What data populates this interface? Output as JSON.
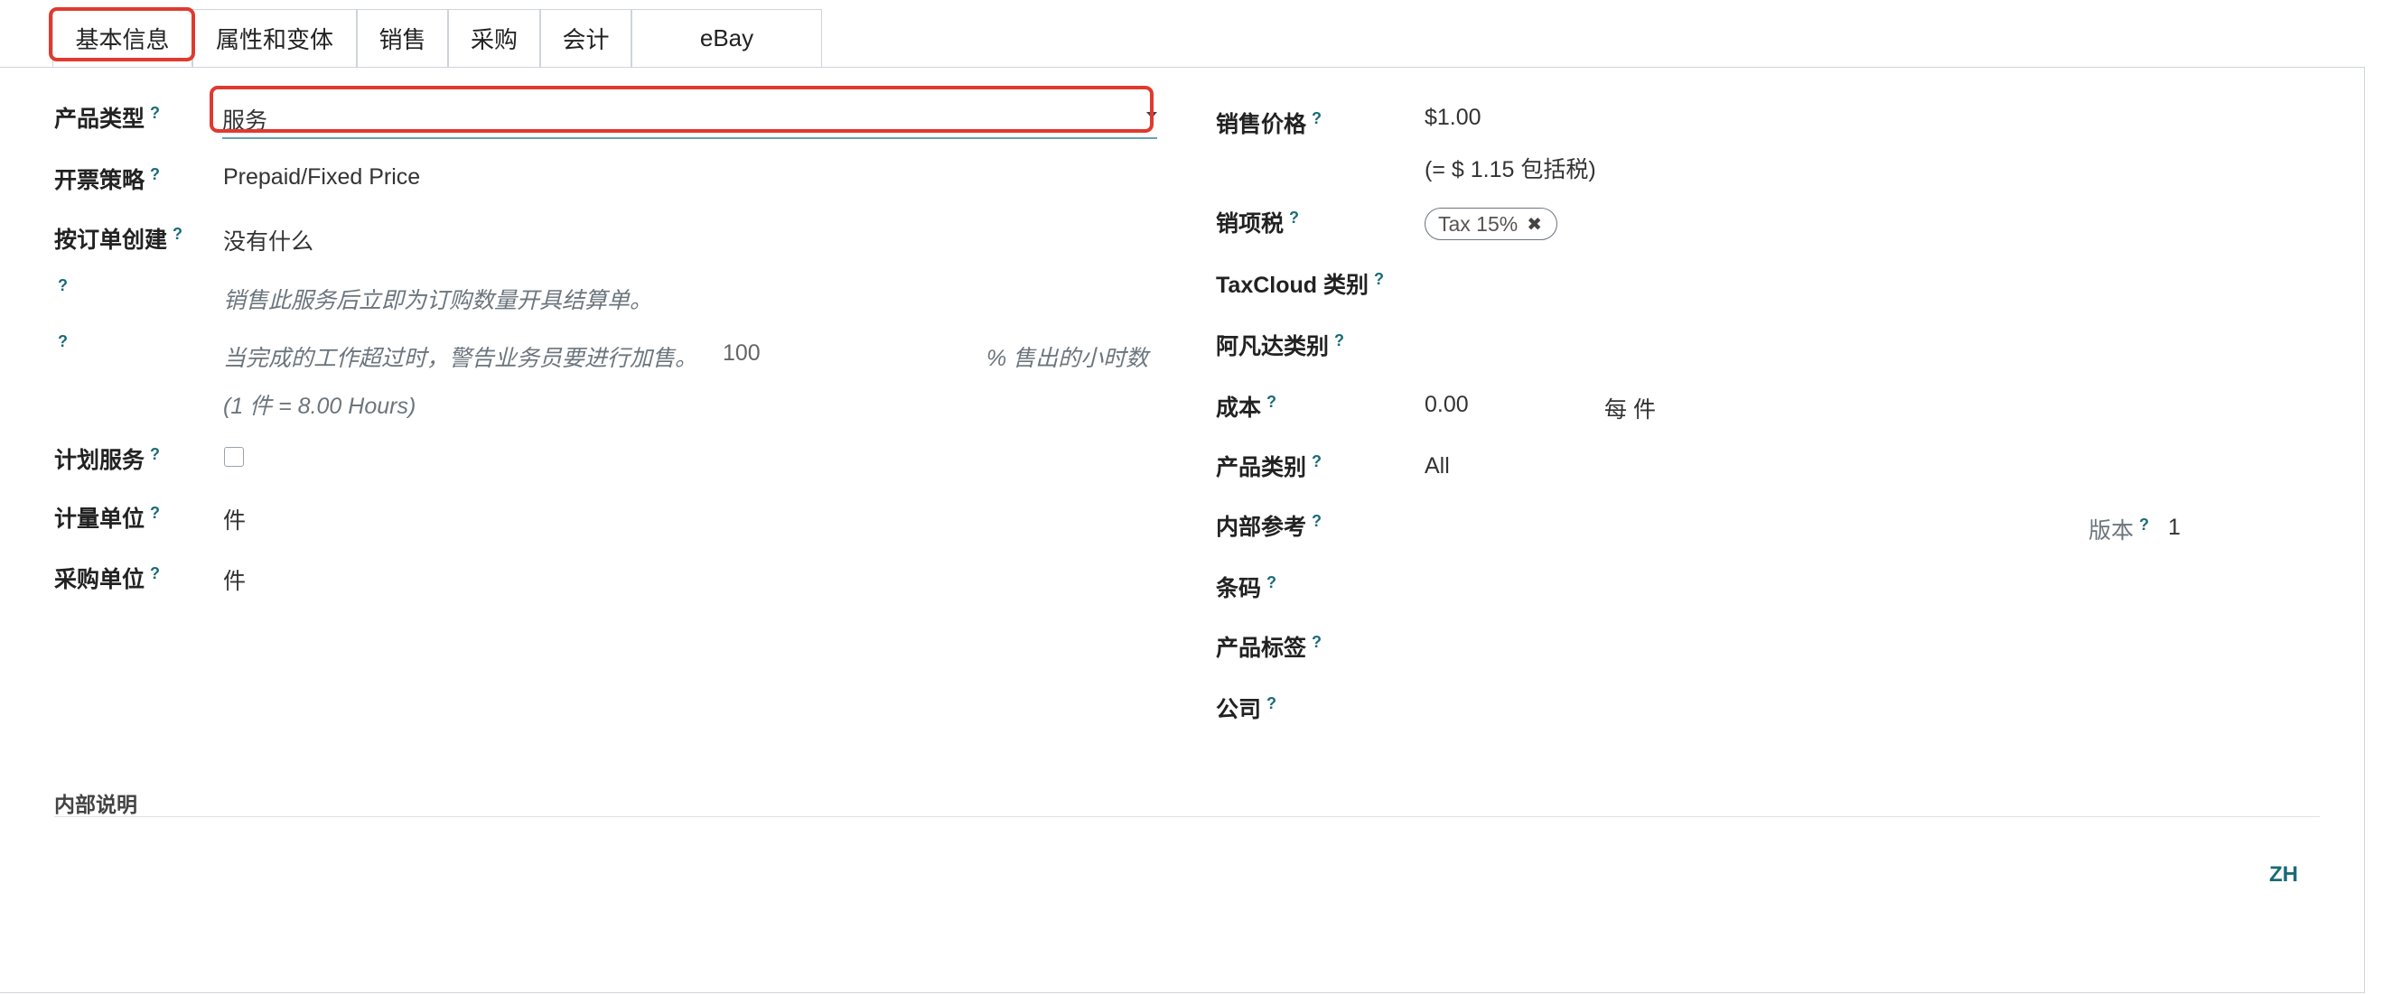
{
  "tabs": [
    {
      "label": "基本信息",
      "active": true
    },
    {
      "label": "属性和变体",
      "active": false
    },
    {
      "label": "销售",
      "active": false
    },
    {
      "label": "采购",
      "active": false
    },
    {
      "label": "会计",
      "active": false
    },
    {
      "label": "eBay",
      "active": false
    }
  ],
  "help_mark": "?",
  "left": {
    "product_type": {
      "label": "产品类型",
      "value": "服务"
    },
    "invoice_policy": {
      "label": "开票策略",
      "value": "Prepaid/Fixed Price"
    },
    "create_on_order": {
      "label": "按订单创建",
      "value": "没有什么"
    },
    "service_invoice_hint": "销售此服务后立即为订购数量开具结算单。",
    "upsell_warning": {
      "text": "当完成的工作超过时，警告业务员要进行加售。",
      "value": "100",
      "unit": "% 售出的小时数"
    },
    "uom_conversion": "(1 件 = 8.00 Hours)",
    "plan_service": {
      "label": "计划服务",
      "checked": false
    },
    "uom": {
      "label": "计量单位",
      "value": "件"
    },
    "purchase_uom": {
      "label": "采购单位",
      "value": "件"
    }
  },
  "right": {
    "sales_price": {
      "label": "销售价格",
      "value": "$1.00",
      "tax_included": "(= $ 1.15 包括税)"
    },
    "sales_tax": {
      "label": "销项税",
      "tag": "Tax 15%"
    },
    "taxcloud_category": {
      "label": "TaxCloud 类别"
    },
    "avalara_category": {
      "label": "阿凡达类别"
    },
    "cost": {
      "label": "成本",
      "value": "0.00",
      "per": "每 件"
    },
    "product_category": {
      "label": "产品类别",
      "value": "All"
    },
    "internal_ref": {
      "label": "内部参考"
    },
    "version": {
      "label": "版本",
      "value": "1"
    },
    "barcode": {
      "label": "条码"
    },
    "product_tags": {
      "label": "产品标签"
    },
    "company": {
      "label": "公司"
    }
  },
  "internal_notes": {
    "title": "内部说明"
  },
  "language_badge": "ZH",
  "highlight_color": "#e03a2f"
}
